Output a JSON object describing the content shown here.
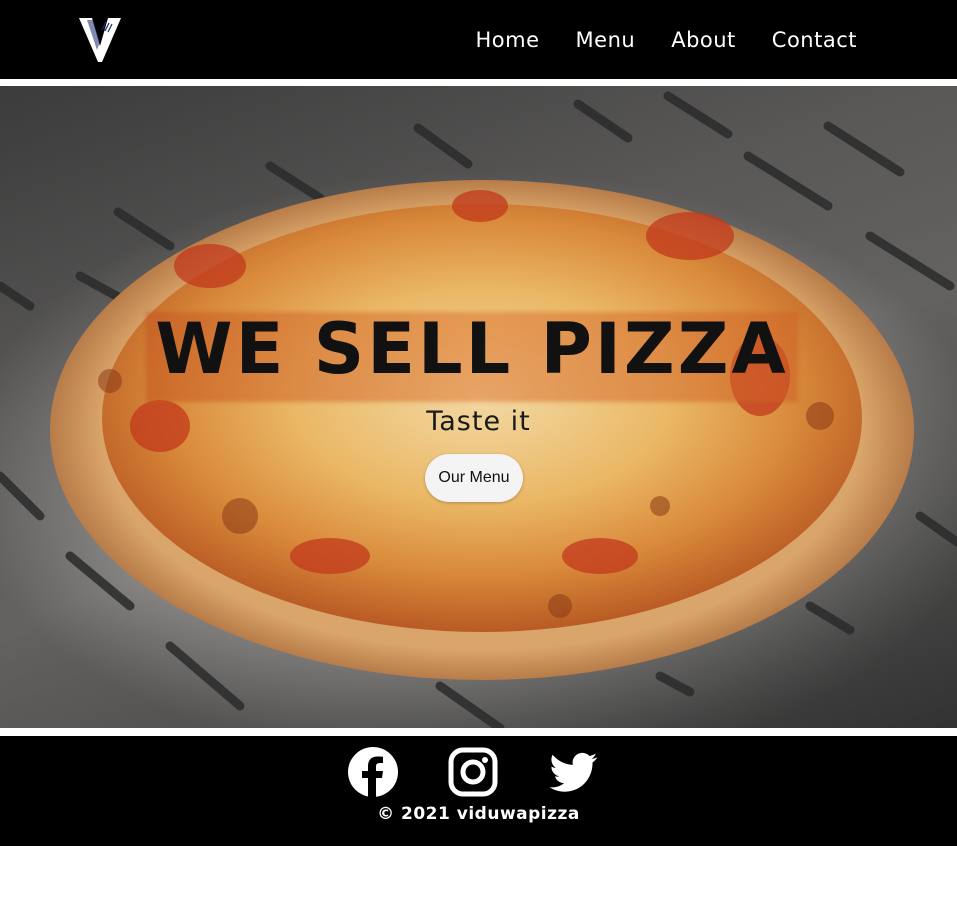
{
  "brand": {
    "logo_icon": "v-logo-icon"
  },
  "nav": {
    "items": [
      {
        "label": "Home"
      },
      {
        "label": "Menu"
      },
      {
        "label": "About"
      },
      {
        "label": "Contact"
      }
    ]
  },
  "hero": {
    "title": "WE SELL PIZZA",
    "subtitle": "Taste it",
    "button_label": "Our Menu",
    "image": "pizza-on-peel-image"
  },
  "footer": {
    "social": [
      {
        "icon": "facebook-icon"
      },
      {
        "icon": "instagram-icon"
      },
      {
        "icon": "twitter-icon"
      }
    ],
    "copyright": "© 2021 viduwapizza"
  },
  "colors": {
    "nav_background": "#000000",
    "nav_text": "#ffffff",
    "footer_background": "#000000",
    "button_background": "#f4f4f4",
    "title_text": "#111111"
  }
}
